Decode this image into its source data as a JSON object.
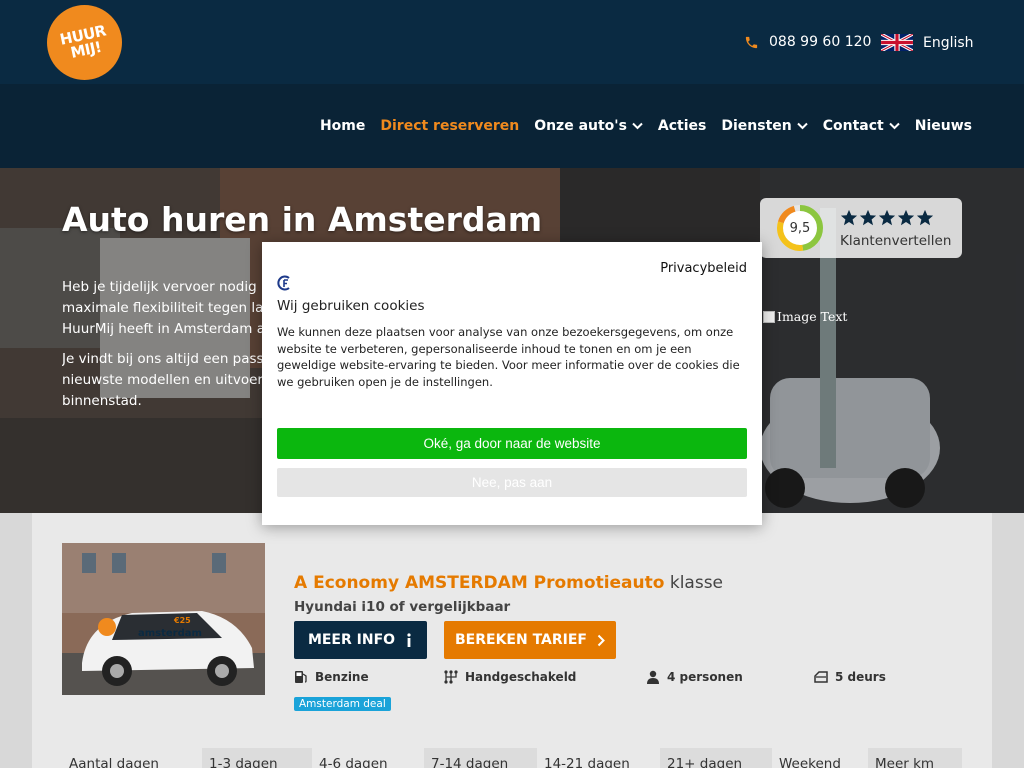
{
  "header": {
    "logo_text": "HUUR MIJ!",
    "phone": "088 99 60 120",
    "language": "English"
  },
  "nav": {
    "items": [
      {
        "label": "Home",
        "active": false,
        "dropdown": false
      },
      {
        "label": "Direct reserveren",
        "active": true,
        "dropdown": false
      },
      {
        "label": "Onze auto's",
        "active": false,
        "dropdown": true
      },
      {
        "label": "Acties",
        "active": false,
        "dropdown": false
      },
      {
        "label": "Diensten",
        "active": false,
        "dropdown": true
      },
      {
        "label": "Contact",
        "active": false,
        "dropdown": true
      },
      {
        "label": "Nieuws",
        "active": false,
        "dropdown": false
      }
    ]
  },
  "hero": {
    "title": "Auto huren in Amsterdam",
    "paragraph1": [
      "Heb je tijdelijk vervoer nodig in",
      "maximale flexibiliteit tegen lage",
      "HuurMij heeft in Amsterdam au"
    ],
    "paragraph2": [
      "Je vindt bij ons altijd een passe",
      "nieuwste modellen en uitvoerin",
      "binnenstad."
    ],
    "rating_score": "9,5",
    "rating_label": "Klantenvertellen",
    "rating_stars": 5,
    "broken_image_alt": "Image Text"
  },
  "cookie": {
    "policy_link": "Privacybeleid",
    "title": "Wij gebruiken cookies",
    "body": "We kunnen deze plaatsen voor analyse van onze bezoekersgegevens, om onze website te verbeteren, gepersonaliseerde inhoud te tonen en om je een geweldige website-ervaring te bieden. Voor meer informatie over de cookies die we gebruiken open je de instellingen.",
    "accept_label": "Oké, ga door naar de website",
    "reject_label": "Nee, pas aan"
  },
  "car": {
    "title_brand": "A Economy AMSTERDAM Promotieauto",
    "title_suffix": " klasse",
    "model": "Hyundai i10 of vergelijkbaar",
    "info_label": "MEER INFO",
    "tarief_label": "BEREKEN TARIEF",
    "specs": {
      "fuel": "Benzine",
      "transmission": "Handgeschakeld",
      "persons": "4 personen",
      "doors": "5 deurs"
    },
    "badge": "Amsterdam deal",
    "photo_text": "amsterdam",
    "photo_price": "€25"
  },
  "price_table": {
    "headers": [
      "Aantal dagen",
      "1-3 dagen",
      "4-6 dagen",
      "7-14 dagen",
      "14-21 dagen",
      "21+ dagen",
      "Weekend",
      "Meer km"
    ]
  },
  "colors": {
    "accent": "#e57a00",
    "navy": "#0a2a42",
    "accept_green": "#0bb70e",
    "badge_blue": "#1aa3d9"
  }
}
